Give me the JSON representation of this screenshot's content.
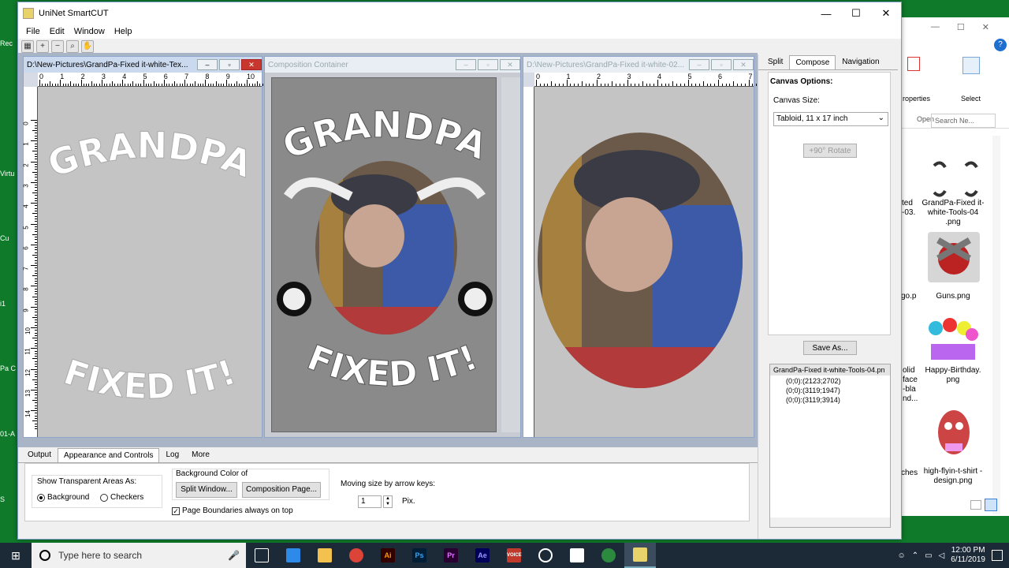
{
  "desktop_icons": [
    "Rec",
    "Virtu",
    "Cu",
    "i1",
    "Pa C",
    "01-A",
    "S"
  ],
  "explorer": {
    "title_buttons": [
      "—",
      "☐",
      "✕"
    ],
    "ribbon": {
      "properties": "roperties",
      "open": "Open",
      "select": "Select"
    },
    "search_placeholder": "Search Ne...",
    "files": [
      {
        "name": "GrandPa-Fixed it-white-Tools-04 .png"
      },
      {
        "name": "Guns.png"
      },
      {
        "name": "Happy-Birthday. png"
      },
      {
        "name": "high-flyin-t-shirt -design.png"
      }
    ],
    "partial_labels": [
      "ted",
      "-03.",
      "go.p",
      "olid",
      "face",
      "-bla",
      "nd...",
      "ches"
    ]
  },
  "app": {
    "title": "UniNet SmartCUT",
    "menu": [
      "File",
      "Edit",
      "Window",
      "Help"
    ],
    "toolbar_icons": [
      "select-icon",
      "zoom-in-icon",
      "zoom-out-icon",
      "zoom-fit-icon",
      "hand-icon"
    ]
  },
  "panes": {
    "left": {
      "title": "D:\\New-Pictures\\GrandPa-Fixed it-white-Tex..."
    },
    "center": {
      "title": "Composition Container"
    },
    "right": {
      "title": "D:\\New-Pictures\\GrandPa-Fixed it-white-02..."
    }
  },
  "artwork": {
    "top_text": "GRANDPA",
    "bottom_text": "FIXED IT!"
  },
  "ruler_h_labels": [
    "0",
    "1",
    "2",
    "3",
    "4",
    "5",
    "6",
    "7",
    "8",
    "9",
    "10"
  ],
  "ruler_h_labels_right": [
    "0",
    "1",
    "2",
    "3",
    "4",
    "5",
    "6",
    "7"
  ],
  "ruler_v_labels": [
    "0",
    "1",
    "2",
    "3",
    "4",
    "5",
    "6",
    "7",
    "8",
    "9",
    "10",
    "11",
    "12",
    "13",
    "14"
  ],
  "right_panel": {
    "tabs": [
      "Split",
      "Compose",
      "Navigation"
    ],
    "active_tab": "Compose",
    "canvas_options": "Canvas Options:",
    "canvas_size_label": "Canvas Size:",
    "canvas_size_value": "Tabloid, 11 x 17 inch",
    "rotate_button": "+90° Rotate",
    "save_button": "Save As...",
    "tree_root": "GrandPa-Fixed it-white-Tools-04.pn",
    "tree_items": [
      "(0;0):(2123;2702)",
      "(0;0):(3119;1947)",
      "(0;0):(3119;3914)"
    ]
  },
  "bottom_panel": {
    "tabs": [
      "Output",
      "Appearance and Controls",
      "Log",
      "More"
    ],
    "active_tab": "Appearance and Controls",
    "transparent_label": "Show Transparent Areas As:",
    "radio_background": "Background",
    "radio_checkers": "Checkers",
    "bg_color_label": "Background Color of",
    "split_window_btn": "Split Window...",
    "composition_page_btn": "Composition Page...",
    "page_boundaries": "Page Boundaries always on top",
    "moving_size_label": "Moving size by arrow keys:",
    "moving_size_value": "1",
    "pix_label": "Pix."
  },
  "taskbar": {
    "search_placeholder": "Type here to search",
    "time": "12:00 PM",
    "date": "6/11/2019",
    "apps": [
      "Ai",
      "Ps",
      "Pr",
      "Ae"
    ]
  },
  "colors": {
    "taskbar": "#1c2a38",
    "desktop": "#0f7a2a",
    "ai": "#ff9a00",
    "ps": "#31a8ff",
    "pr": "#9999ff",
    "ae": "#9999ff"
  }
}
